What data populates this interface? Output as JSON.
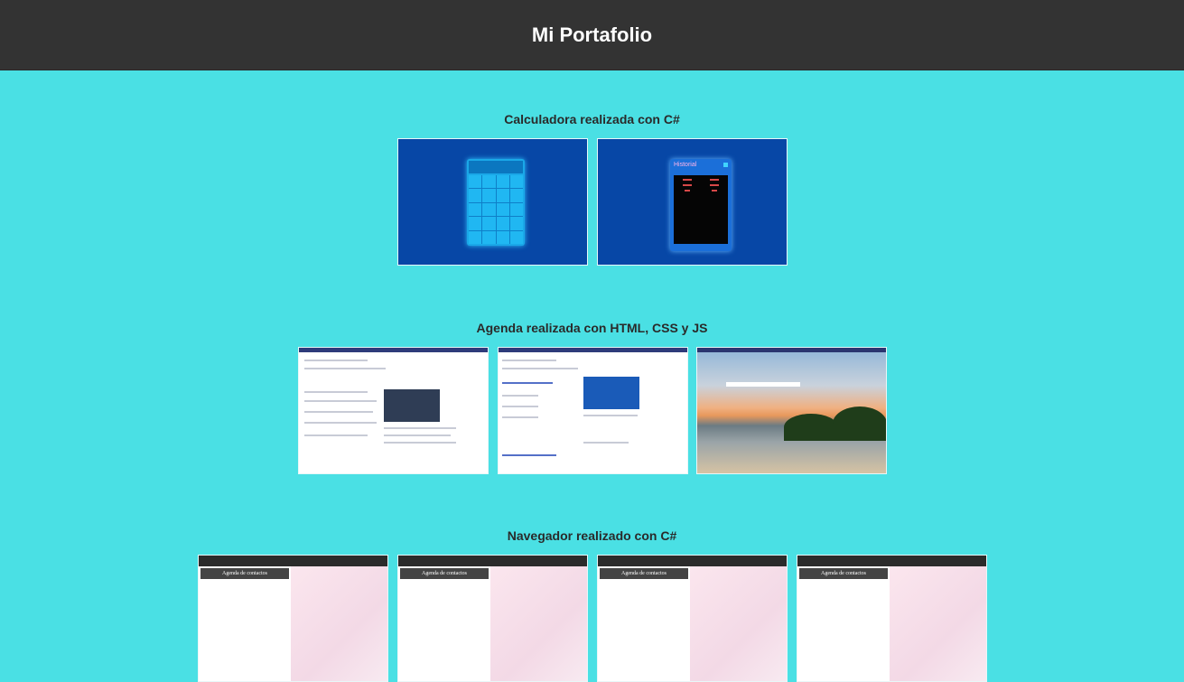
{
  "header": {
    "title": "Mi Portafolio"
  },
  "sections": [
    {
      "title": "Calculadora realizada con C#"
    },
    {
      "title": "Agenda realizada con HTML, CSS y JS"
    },
    {
      "title": "Navegador realizado con C#"
    }
  ],
  "calculator": {
    "history_title": "Historial"
  },
  "navigator": {
    "panel_title": "Agenda de contactos"
  },
  "colors": {
    "page_background": "#4ae0e4",
    "header_background": "#333333",
    "thumbnail_blue": "#0747a6"
  }
}
